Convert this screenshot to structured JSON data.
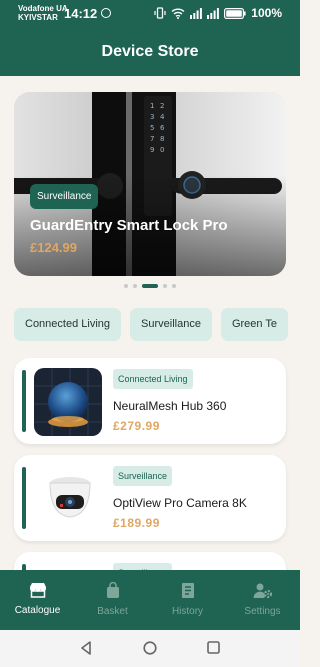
{
  "status_bar": {
    "carrier_line1": "Vodafone UA",
    "carrier_line2": "KYIVSTAR",
    "time": "14:12",
    "battery": "100%"
  },
  "app": {
    "title": "Device Store"
  },
  "hero": {
    "category": "Surveillance",
    "title": "GuardEntry Smart Lock Pro",
    "price": "£124.99",
    "page_count": 5,
    "active_page": 2
  },
  "categories": [
    "Connected Living",
    "Surveillance",
    "Green Te"
  ],
  "products": [
    {
      "category": "Connected Living",
      "name": "NeuralMesh Hub 360",
      "price": "£279.99",
      "image": "smart-speaker"
    },
    {
      "category": "Surveillance",
      "name": "OptiView Pro Camera 8K",
      "price": "£189.99",
      "image": "security-camera"
    },
    {
      "category": "Surveillance",
      "name": "",
      "price": "",
      "image": ""
    }
  ],
  "bottom_nav": [
    {
      "label": "Catalogue",
      "icon": "store-icon",
      "active": true
    },
    {
      "label": "Basket",
      "icon": "bag-icon",
      "active": false
    },
    {
      "label": "History",
      "icon": "receipt-icon",
      "active": false
    },
    {
      "label": "Settings",
      "icon": "gear-person-icon",
      "active": false
    }
  ],
  "colors": {
    "primary": "#1f6352",
    "accent_price": "#e0a763",
    "chip_bg": "#d7ece6",
    "background": "#f6f3ee"
  }
}
